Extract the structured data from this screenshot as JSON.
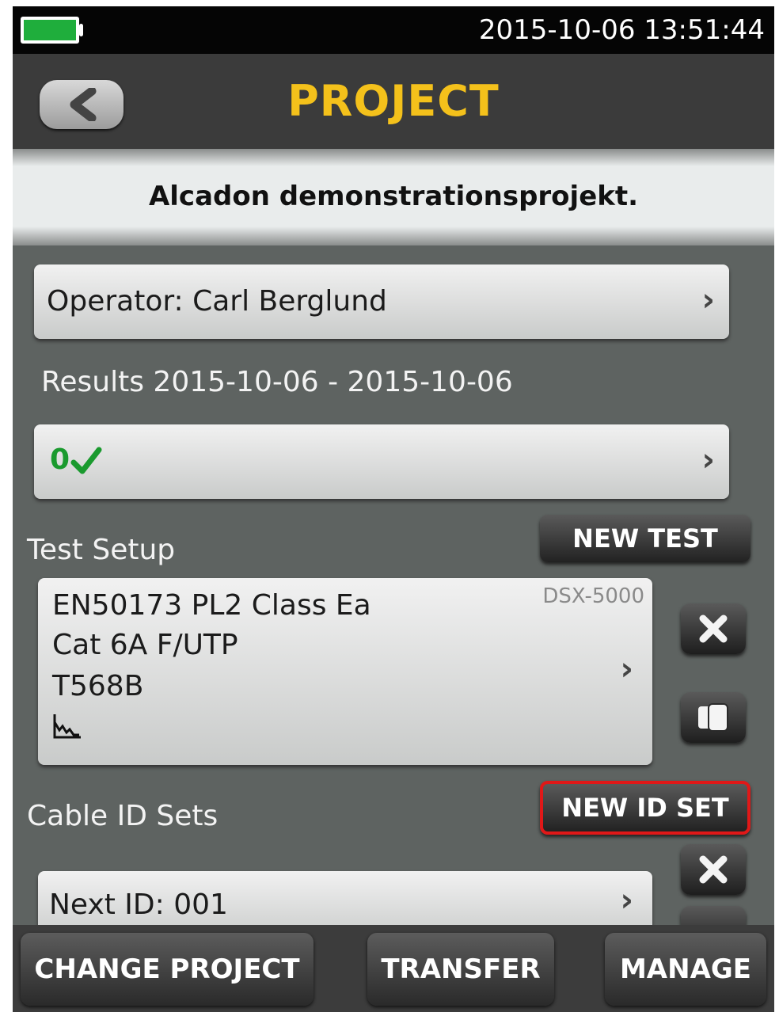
{
  "status": {
    "datetime": "2015-10-06 13:51:44",
    "battery_color": "#1fae3c"
  },
  "header": {
    "title": "PROJECT",
    "title_color": "#f4c11b",
    "back_icon": "chevron-left-icon"
  },
  "project": {
    "name": "Alcadon demonstrationsprojekt."
  },
  "operator": {
    "label": "Operator: Carl Berglund"
  },
  "results": {
    "label": "Results 2015-10-06 - 2015-10-06",
    "count": "0",
    "status_icon": "checkmark-icon"
  },
  "test_setup": {
    "section_label": "Test Setup",
    "new_button": "NEW TEST",
    "line1": "EN50173 PL2 Class Ea",
    "line2": "Cat 6A F/UTP",
    "line3": "T568B",
    "device": "DSX-5000",
    "graph_icon": "graph-icon"
  },
  "cable_ids": {
    "section_label": "Cable ID Sets",
    "new_button": "NEW ID SET",
    "next_id": "Next ID: 001"
  },
  "bottom": {
    "change_project": "CHANGE PROJECT",
    "transfer": "TRANSFER",
    "manage": "MANAGE"
  },
  "highlight_color": "#e01818"
}
